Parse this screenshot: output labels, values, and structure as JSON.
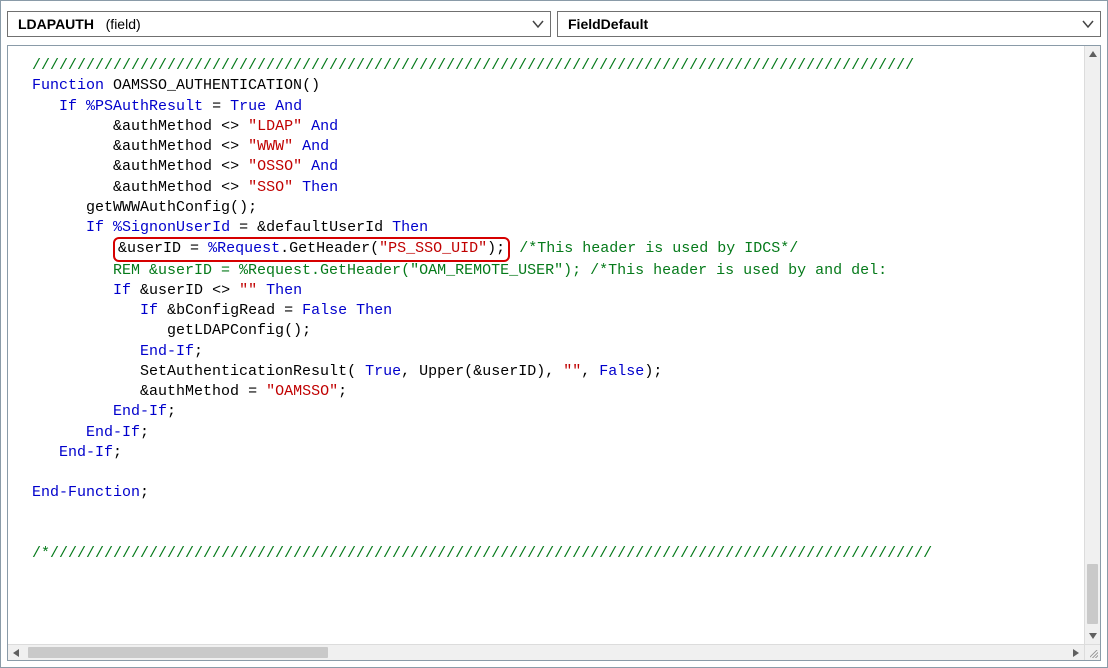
{
  "dropdowns": {
    "left": {
      "name": "LDAPAUTH",
      "qualifier": "(field)"
    },
    "right": {
      "event": "FieldDefault"
    }
  },
  "code": {
    "commentBar": "//////////////////////////////////////////////////////////////////////////////////////////////////",
    "funcKw": "Function",
    "funcName": "OAMSSO_AUTHENTICATION",
    "lparen": "(",
    "rparen": ")",
    "ifKw": "If",
    "thenKw": "Then",
    "psAuthResult": "%PSAuthResult",
    "eq": "=",
    "ne": "<>",
    "true": "True",
    "false": "False",
    "andKw": "And",
    "authMethodVar": "&authMethod",
    "strLDAP": "\"LDAP\"",
    "strWWW": "\"WWW\"",
    "strOSSO": "\"OSSO\"",
    "strSSO": "\"SSO\"",
    "getWWWAuthConfig": "getWWWAuthConfig",
    "signonUserId": "%SignonUserId",
    "defaultUserId": "&defaultUserId",
    "userIDVar": "&userID",
    "request": "%Request",
    "getHeader": ".GetHeader",
    "strPSSSO": "\"PS_SSO_UID\"",
    "cmtIDCS": "/*This header is used by IDCS*/",
    "remLine": "REM &userID = %Request.GetHeader(\"OAM_REMOTE_USER\"); /*This header is used by and del:",
    "emptyStr": "\"\"",
    "bConfigRead": "&bConfigRead",
    "getLDAPConfig": "getLDAPConfig",
    "setAuthResult": "SetAuthenticationResult",
    "upper": "Upper",
    "strOAMSSO": "\"OAMSSO\"",
    "endIfKw": "End-If",
    "endFuncKw": "End-Function",
    "semi": ";",
    "comma": ",",
    "sp": " ",
    "trailCmt": "/*//////////////////////////////////////////////////////////////////////////////////////////////////"
  }
}
